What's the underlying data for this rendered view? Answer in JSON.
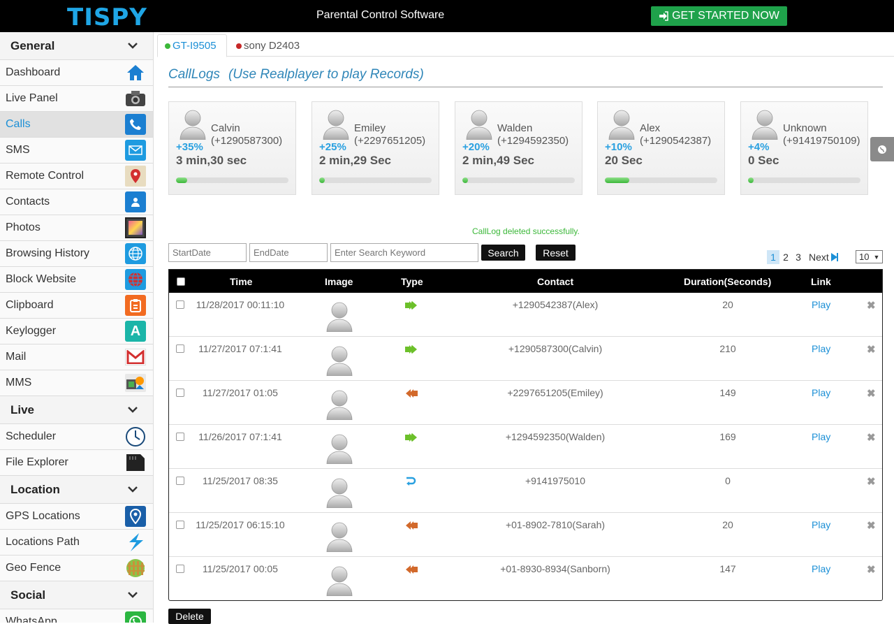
{
  "header": {
    "logo": "TISPY",
    "tagline": "Parental Control Software",
    "cta_label": "GET STARTED NOW"
  },
  "sidebar": {
    "sections": [
      {
        "title": "General",
        "items": [
          {
            "label": "Dashboard",
            "icon": "home-icon"
          },
          {
            "label": "Live Panel",
            "icon": "camera-icon"
          },
          {
            "label": "Calls",
            "icon": "phone-icon",
            "active": true
          },
          {
            "label": "SMS",
            "icon": "envelope-icon"
          },
          {
            "label": "Remote Control",
            "icon": "map-pin-icon"
          },
          {
            "label": "Contacts",
            "icon": "contact-card-icon"
          },
          {
            "label": "Photos",
            "icon": "photo-icon"
          },
          {
            "label": "Browsing History",
            "icon": "globe-icon"
          },
          {
            "label": "Block Website",
            "icon": "blocked-globe-icon"
          },
          {
            "label": "Clipboard",
            "icon": "clipboard-icon"
          },
          {
            "label": "Keylogger",
            "icon": "keyboard-a-icon"
          },
          {
            "label": "Mail",
            "icon": "gmail-icon"
          },
          {
            "label": "MMS",
            "icon": "mms-icon"
          }
        ]
      },
      {
        "title": "Live",
        "items": [
          {
            "label": "Scheduler",
            "icon": "clock-icon"
          },
          {
            "label": "File Explorer",
            "icon": "sd-card-icon"
          }
        ]
      },
      {
        "title": "Location",
        "items": [
          {
            "label": "GPS Locations",
            "icon": "location-pin-icon"
          },
          {
            "label": "Locations Path",
            "icon": "path-icon"
          },
          {
            "label": "Geo Fence",
            "icon": "fence-icon"
          }
        ]
      },
      {
        "title": "Social",
        "items": [
          {
            "label": "WhatsApp",
            "icon": "whatsapp-icon"
          }
        ]
      }
    ]
  },
  "tabs": [
    {
      "label": "GT-I9505",
      "dot_color": "#3cb83a",
      "active": true
    },
    {
      "label": "sony D2403",
      "dot_color": "#c62828",
      "active": false
    }
  ],
  "page": {
    "title": "CallLogs",
    "subtitle": "(Use Realplayer to play Records)",
    "status_message": "CallLog deleted successfully."
  },
  "top_contacts": [
    {
      "name": "Calvin",
      "phone": "(+1290587300)",
      "percent": "+35%",
      "duration": "3 min,30 sec",
      "fill": 0.1
    },
    {
      "name": "Emiley",
      "phone": "(+2297651205)",
      "percent": "+25%",
      "duration": "2 min,29 Sec",
      "fill": 0.05
    },
    {
      "name": "Walden",
      "phone": "(+1294592350)",
      "percent": "+20%",
      "duration": "2 min,49 Sec",
      "fill": 0.05
    },
    {
      "name": "Alex",
      "phone": "(+1290542387)",
      "percent": "+10%",
      "duration": "20 Sec",
      "fill": 0.22
    },
    {
      "name": "Unknown",
      "phone": "(+91419750109)",
      "percent": "+4%",
      "duration": "0 Sec",
      "fill": 0.05
    }
  ],
  "filters": {
    "start_placeholder": "StartDate",
    "end_placeholder": "EndDate",
    "search_placeholder": "Enter Search Keyword",
    "search_label": "Search",
    "reset_label": "Reset"
  },
  "pagination": {
    "pages": [
      "1",
      "2",
      "3"
    ],
    "current": "1",
    "next_label": "Next",
    "page_size": "10"
  },
  "table": {
    "headers": [
      "Time",
      "Image",
      "Type",
      "Contact",
      "Duration(Seconds)",
      "Link"
    ],
    "rows": [
      {
        "time": "11/28/2017 00:11:10",
        "type": "outgoing",
        "contact": "+1290542387(Alex)",
        "duration": "20",
        "link": "Play"
      },
      {
        "time": "11/27/2017 07:1:41",
        "type": "outgoing",
        "contact": "+1290587300(Calvin)",
        "duration": "210",
        "link": "Play"
      },
      {
        "time": "11/27/2017 01:05",
        "type": "incoming",
        "contact": "+2297651205(Emiley)",
        "duration": "149",
        "link": "Play"
      },
      {
        "time": "11/26/2017 07:1:41",
        "type": "outgoing",
        "contact": "+1294592350(Walden)",
        "duration": "169",
        "link": "Play"
      },
      {
        "time": "11/25/2017 08:35",
        "type": "missed",
        "contact": "+9141975010",
        "duration": "0",
        "link": ""
      },
      {
        "time": "11/25/2017 06:15:10",
        "type": "incoming",
        "contact": "+01-8902-7810(Sarah)",
        "duration": "20",
        "link": "Play"
      },
      {
        "time": "11/25/2017 00:05",
        "type": "incoming",
        "contact": "+01-8930-8934(Sanborn)",
        "duration": "147",
        "link": "Play"
      }
    ],
    "delete_label": "Delete"
  },
  "colors": {
    "accent": "#1b8fd6",
    "cta": "#1fa24b",
    "outgoing": "#6cc02a",
    "incoming": "#d2692b",
    "missed": "#29a0e0"
  }
}
